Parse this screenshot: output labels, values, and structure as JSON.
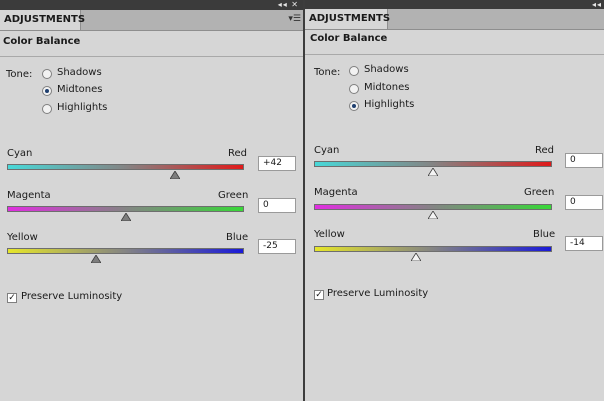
{
  "colors": {
    "accent": "#1f3f6f"
  },
  "panels": [
    {
      "tab_label": "ADJUSTMENTS",
      "window_controls": "◂◂ ✕",
      "title": "Color Balance",
      "tone_label": "Tone:",
      "tones": [
        {
          "label": "Shadows",
          "selected": false
        },
        {
          "label": "Midtones",
          "selected": true
        },
        {
          "label": "Highlights",
          "selected": false
        }
      ],
      "sliders": [
        {
          "left": "Cyan",
          "right": "Red",
          "value": "+42",
          "fraction": 0.71
        },
        {
          "left": "Magenta",
          "right": "Green",
          "value": "0",
          "fraction": 0.5
        },
        {
          "left": "Yellow",
          "right": "Blue",
          "value": "-25",
          "fraction": 0.375
        }
      ],
      "preserve_label": "Preserve Luminosity",
      "preserve_checked": true
    },
    {
      "tab_label": "ADJUSTMENTS",
      "window_controls": "◂◂",
      "title": "Color Balance",
      "tone_label": "Tone:",
      "tones": [
        {
          "label": "Shadows",
          "selected": false
        },
        {
          "label": "Midtones",
          "selected": false
        },
        {
          "label": "Highlights",
          "selected": true
        }
      ],
      "sliders": [
        {
          "left": "Cyan",
          "right": "Red",
          "value": "0",
          "fraction": 0.5
        },
        {
          "left": "Magenta",
          "right": "Green",
          "value": "0",
          "fraction": 0.5
        },
        {
          "left": "Yellow",
          "right": "Blue",
          "value": "-14",
          "fraction": 0.43
        }
      ],
      "preserve_label": "Preserve Luminosity",
      "preserve_checked": true
    }
  ]
}
